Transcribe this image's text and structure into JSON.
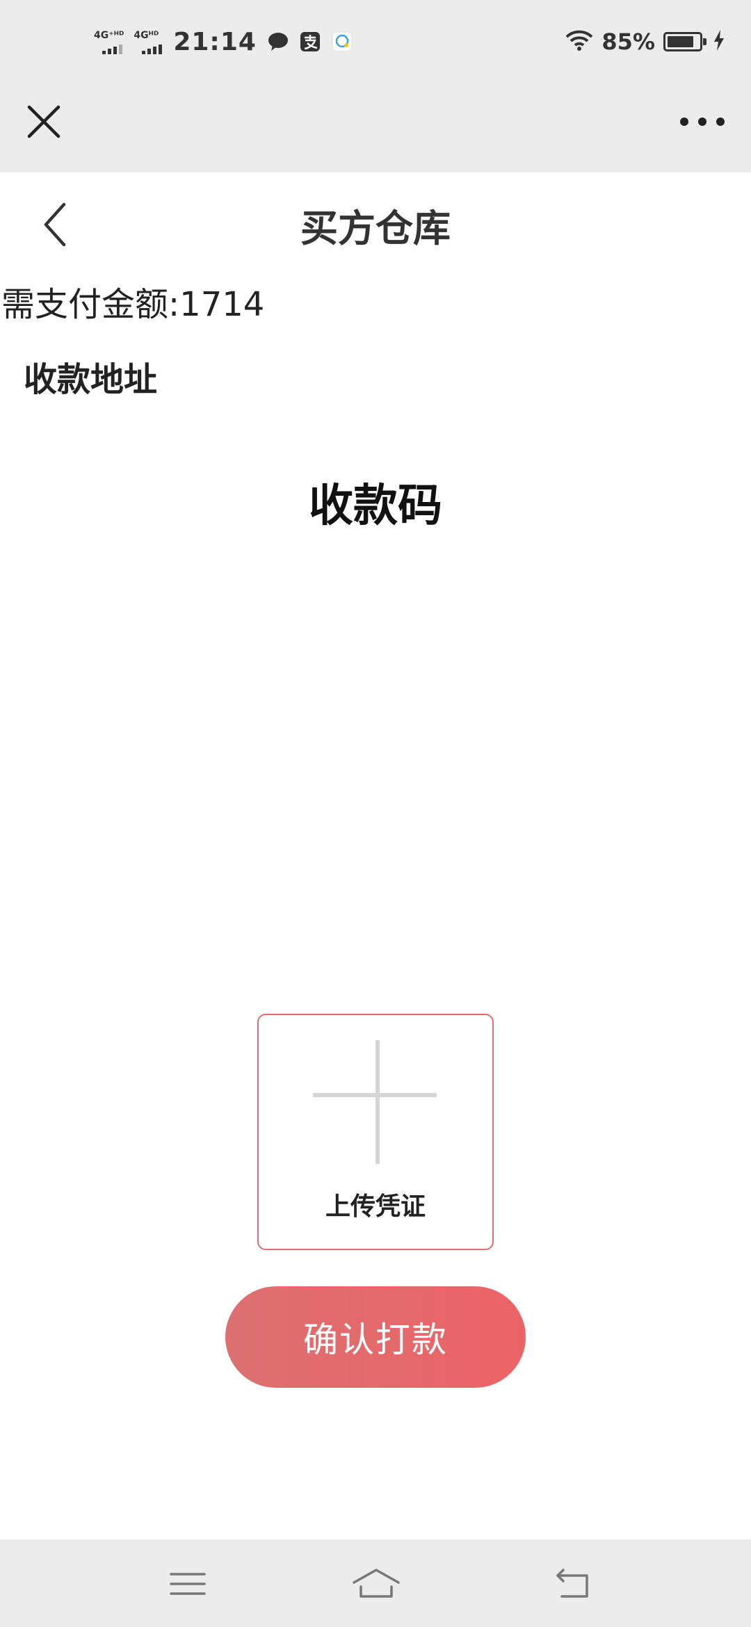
{
  "status_bar": {
    "network1": "4G⁺ᴴᴰ",
    "network2": "4Gᴴᴰ",
    "time": "21:14",
    "battery_percent": "85%",
    "battery_level": 0.85
  },
  "top_bar": {
    "close_icon": "close-icon",
    "more_icon": "more-dots-icon"
  },
  "header": {
    "title": "买方仓库",
    "back_icon": "chevron-left-icon"
  },
  "payment": {
    "amount_text": "需支付金额:1714",
    "address_label": "收款地址",
    "qr_title": "收款码"
  },
  "upload": {
    "label": "上传凭证",
    "icon": "plus-icon"
  },
  "confirm_button": {
    "label": "确认打款"
  },
  "colors": {
    "accent": "#e86669",
    "border": "#e06c6c",
    "bar_bg": "#ececec"
  }
}
